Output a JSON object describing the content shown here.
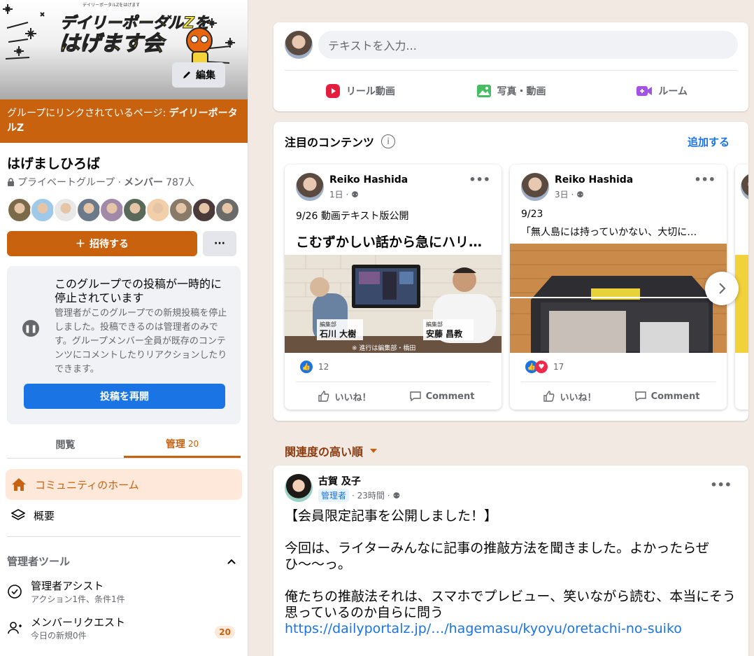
{
  "sidebar": {
    "cover": {
      "logo_top_small": "デイリーポータルZをはげます",
      "logo_title_line1": "デイリーポータルZを",
      "logo_title_line2": "はげます会",
      "edit_label": "編集"
    },
    "linked_page_prefix": "グループにリンクされているページ: ",
    "linked_page_name": "デイリーポータルZ",
    "group_name": "はげましひろば",
    "privacy": "プライベートグループ · ",
    "members_label": "メンバー",
    "members_count": "787人",
    "avatar_colors": [
      "#7a6a4a",
      "#9ec9e8",
      "#e8e8e8",
      "#6a7a8a",
      "#a08aa8",
      "#5a6a5a",
      "#f2cfa8",
      "#8a7a6a",
      "#4a3a3a",
      "#6a6a6a"
    ],
    "invite_label": "招待する",
    "more_label": "···",
    "paused": {
      "title": "このグループでの投稿が一時的に停止されています",
      "desc": "管理者がこのグループでの新規投稿を停止しました。投稿できるのは管理者のみです。グループメンバー全員が既存のコンテンツにコメントしたりリアクションしたりできます。",
      "resume_label": "投稿を再開"
    },
    "tabs": [
      {
        "label": "閲覧",
        "count": ""
      },
      {
        "label": "管理",
        "count": "20"
      }
    ],
    "nav": [
      {
        "label": "コミュニティのホーム"
      },
      {
        "label": "概要"
      }
    ],
    "admin_tools_title": "管理者ツール",
    "tools": [
      {
        "title": "管理者アシスト",
        "sub": "アクション1件、条件1件",
        "badge": ""
      },
      {
        "title": "メンバーリクエスト",
        "sub": "今日の新規0件",
        "badge": "20"
      }
    ]
  },
  "composer": {
    "placeholder": "テキストを入力...",
    "options": [
      {
        "label": "リール動画",
        "color": "#e41e3f"
      },
      {
        "label": "写真・動画",
        "color": "#45bd62"
      },
      {
        "label": "ルーム",
        "color": "#a550e6"
      }
    ]
  },
  "featured": {
    "title": "注目のコンテンツ",
    "add_label": "追加する",
    "cards": [
      {
        "author": "Reiko Hashida",
        "time": "1日 · ",
        "line1": "9/26 動画テキスト版公開",
        "line2": "",
        "big": "こむずかしい話から急にハリ…",
        "person1_role": "編集部",
        "person1_name": "石川 大樹",
        "person2_role": "編集部",
        "person2_name": "安藤 昌教",
        "caption": "※ 進行は編集部・橋田",
        "react_count": "12",
        "like_label": "いいね！",
        "comment_label": "Comment"
      },
      {
        "author": "Reiko Hashida",
        "time": "3日 · ",
        "line1": "9/23",
        "line2": "「無人島には持っていかない、大切に…",
        "big": "",
        "react_count": "17",
        "like_label": "いいね！",
        "comment_label": "Comment"
      }
    ]
  },
  "sort_label": "関連度の高い順",
  "post": {
    "author": "古賀 及子",
    "role": "管理者",
    "time": " · 23時間 · ",
    "body_line1": "【会員限定記事を公開しました！】",
    "body_line2": "今回は、ライターみんなに記事の推敲方法を聞きました。よかったらぜひ〜〜っ。",
    "body_line3": "俺たちの推敲法それは、スマホでプレビュー、笑いながら読む、本当にそう思っているのか自らに問う",
    "link": "https://dailyportalz.jp/…/hagemasu/kyoyu/oretachi-no-suiko"
  }
}
